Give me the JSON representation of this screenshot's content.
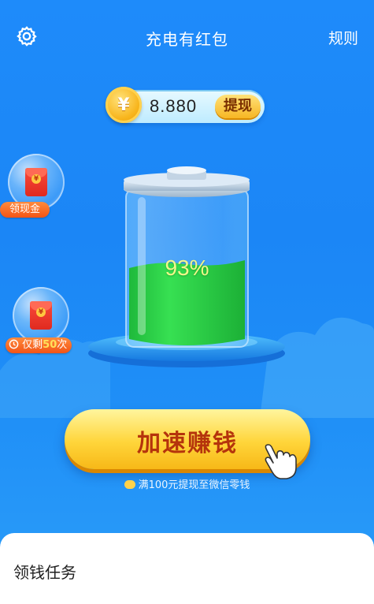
{
  "header": {
    "title": "充电有红包",
    "rules_label": "规则"
  },
  "balance": {
    "amount": "8.880",
    "coin_symbol": "¥",
    "withdraw_label": "提现"
  },
  "side_bubbles": [
    {
      "label": "领现金"
    },
    {
      "label_prefix": "仅剩",
      "count": "50",
      "label_suffix": "次"
    }
  ],
  "battery": {
    "percent_label": "93%",
    "level": 0.93
  },
  "cta": {
    "label": "加速赚钱"
  },
  "note": {
    "text": "满100元提现至微信零钱"
  },
  "tasks": {
    "title": "领钱任务"
  },
  "colors": {
    "bg": "#1E8BFA",
    "gold": "#FFD53A",
    "green": "#2FD34B",
    "cta_text": "#B5340C"
  },
  "icons": [
    "gear-icon",
    "coin-icon",
    "red-envelope-icon",
    "clock-icon",
    "hand-pointer-icon",
    "wechat-icon"
  ]
}
